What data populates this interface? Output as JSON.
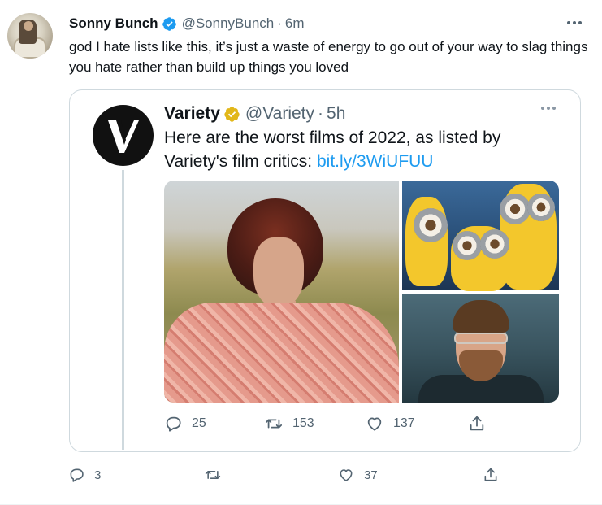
{
  "tweet": {
    "author_name": "Sonny Bunch",
    "author_handle": "@SonnyBunch",
    "separator": "·",
    "time": "6m",
    "text": "god I hate lists like this, it’s just a waste of energy to go out of your way to slag things you hate rather than build up things you loved",
    "actions": {
      "replies": "3",
      "retweets": "",
      "likes": "37"
    }
  },
  "quoted": {
    "author_name": "Variety",
    "author_handle": "@Variety",
    "separator": "·",
    "time": "5h",
    "text_prefix": "Here are the worst films of 2022, as listed by Variety's film critics: ",
    "link": "bit.ly/3WiUFUU",
    "actions": {
      "replies": "25",
      "retweets": "153",
      "likes": "137"
    }
  },
  "colors": {
    "verified": "#1d9bf0",
    "gold_badge": "#e2b719",
    "link": "#1d9bf0",
    "muted": "#536471"
  },
  "icons": [
    "verified-badge-icon",
    "gold-badge-icon",
    "more-icon",
    "reply-icon",
    "retweet-icon",
    "like-icon",
    "share-icon",
    "variety-logo"
  ]
}
